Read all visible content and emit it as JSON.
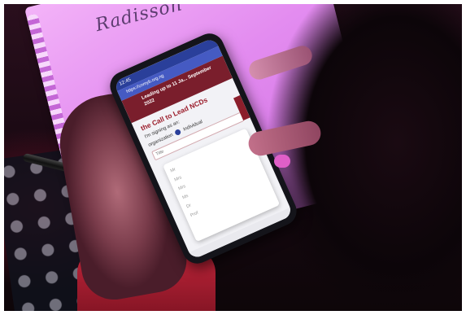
{
  "notepad": {
    "logo_text": "Radisson"
  },
  "phone": {
    "status_time": "12:45",
    "url": "https://cnmyb.org.ng",
    "header_text": "Leading up to 11 Ja... September 2022",
    "title_text": "the Call to Lead NCDs",
    "signing_label": "I'm signing as an:",
    "option_org": "organization",
    "option_individual": "Individual",
    "field_label": "Title",
    "dropdown_options": [
      "Mr",
      "Mrs",
      "Mrs",
      "Ms",
      "Dr",
      "Prof"
    ]
  },
  "colors": {
    "notepad_pink": "#e38cf0",
    "site_maroon": "#7a1e2c",
    "browser_blue": "#2a3f9a",
    "nail_pink": "#e05fc8"
  }
}
